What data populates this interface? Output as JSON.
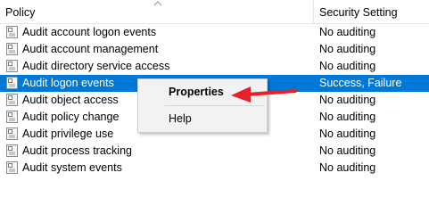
{
  "columns": {
    "policy": "Policy",
    "setting": "Security Setting"
  },
  "rows": [
    {
      "policy": "Audit account logon events",
      "setting": "No auditing",
      "selected": false
    },
    {
      "policy": "Audit account management",
      "setting": "No auditing",
      "selected": false
    },
    {
      "policy": "Audit directory service access",
      "setting": "No auditing",
      "selected": false
    },
    {
      "policy": "Audit logon events",
      "setting": "Success, Failure",
      "selected": true
    },
    {
      "policy": "Audit object access",
      "setting": "No auditing",
      "selected": false
    },
    {
      "policy": "Audit policy change",
      "setting": "No auditing",
      "selected": false
    },
    {
      "policy": "Audit privilege use",
      "setting": "No auditing",
      "selected": false
    },
    {
      "policy": "Audit process tracking",
      "setting": "No auditing",
      "selected": false
    },
    {
      "policy": "Audit system events",
      "setting": "No auditing",
      "selected": false
    }
  ],
  "context_menu": {
    "properties": "Properties",
    "help": "Help"
  },
  "colors": {
    "selection": "#0078d7",
    "annotation_arrow": "#e8202a"
  },
  "icons": {
    "row_icon": "policy-setting-icon",
    "sort": "sort-ascending-icon",
    "annotation": "red-arrow-icon"
  }
}
